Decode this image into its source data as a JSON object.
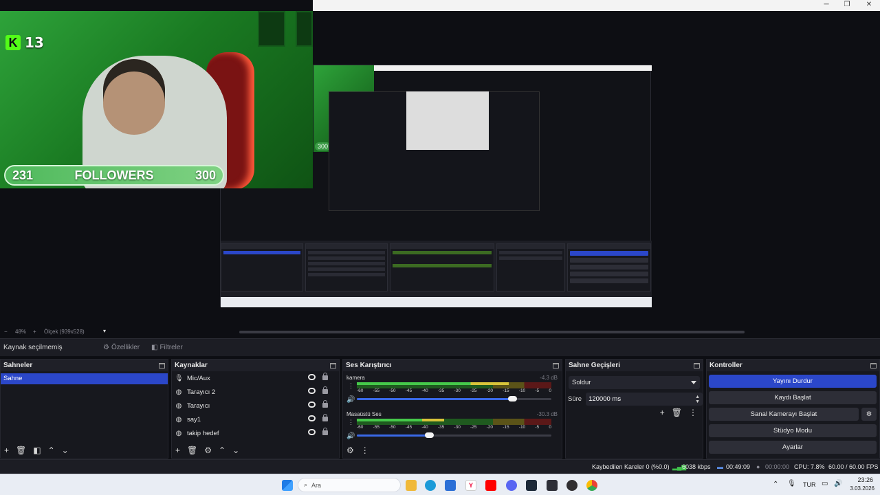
{
  "overlay": {
    "kick_count": "13",
    "followers_current": "231",
    "followers_label": "FOLLOWERS",
    "followers_goal": "300",
    "inner_badge": "300"
  },
  "zoom": {
    "level": "48%",
    "scale_label": "Ölçek (939x528)"
  },
  "source_toolbar": {
    "no_source": "Kaynak seçilmemiş",
    "properties": "Özellikler",
    "filters": "Filtreler"
  },
  "scenes": {
    "title": "Sahneler",
    "items": [
      "Sahne"
    ]
  },
  "sources": {
    "title": "Kaynaklar",
    "items": [
      {
        "label": "Mic/Aux",
        "icon": "microphone-icon"
      },
      {
        "label": "Tarayıcı 2",
        "icon": "globe-icon"
      },
      {
        "label": "Tarayıcı",
        "icon": "globe-icon"
      },
      {
        "label": "say1",
        "icon": "globe-icon"
      },
      {
        "label": "takip hedef",
        "icon": "globe-icon"
      }
    ]
  },
  "mixer": {
    "title": "Ses Karıştırıcı",
    "channels": [
      {
        "name": "kamera",
        "db": "-4.3 dB",
        "level": 0.78,
        "volume": 0.8
      },
      {
        "name": "Masaüstü Ses",
        "db": "-30.3 dB",
        "level": 0.45,
        "volume": 0.37
      }
    ],
    "ticks": [
      "-60",
      "-55",
      "-50",
      "-45",
      "-40",
      "-35",
      "-30",
      "-25",
      "-20",
      "-15",
      "-10",
      "-5",
      "0"
    ]
  },
  "transitions": {
    "title": "Sahne Geçişleri",
    "selected": "Soldur",
    "duration_label": "Süre",
    "duration_value": "120000 ms"
  },
  "controls": {
    "title": "Kontroller",
    "buttons": [
      "Yayını Durdur",
      "Kaydı Başlat",
      "Sanal Kamerayı Başlat",
      "Stüdyo Modu",
      "Ayarlar"
    ]
  },
  "status": {
    "dropped_frames": "Kaybedilen Kareler 0 (%0.0)",
    "bitrate": "6038 kbps",
    "stream_time": "00:49:09",
    "record_time": "00:00:00",
    "cpu": "CPU: 7.8%",
    "fps": "60.00 / 60.00 FPS"
  },
  "taskbar": {
    "search_placeholder": "Ara",
    "language": "TUR",
    "time": "23:26",
    "date": "3.03.2026"
  },
  "colors": {
    "accent": "#2b47c9",
    "panel_bg": "#17181e",
    "kick_green": "#53fc18"
  }
}
